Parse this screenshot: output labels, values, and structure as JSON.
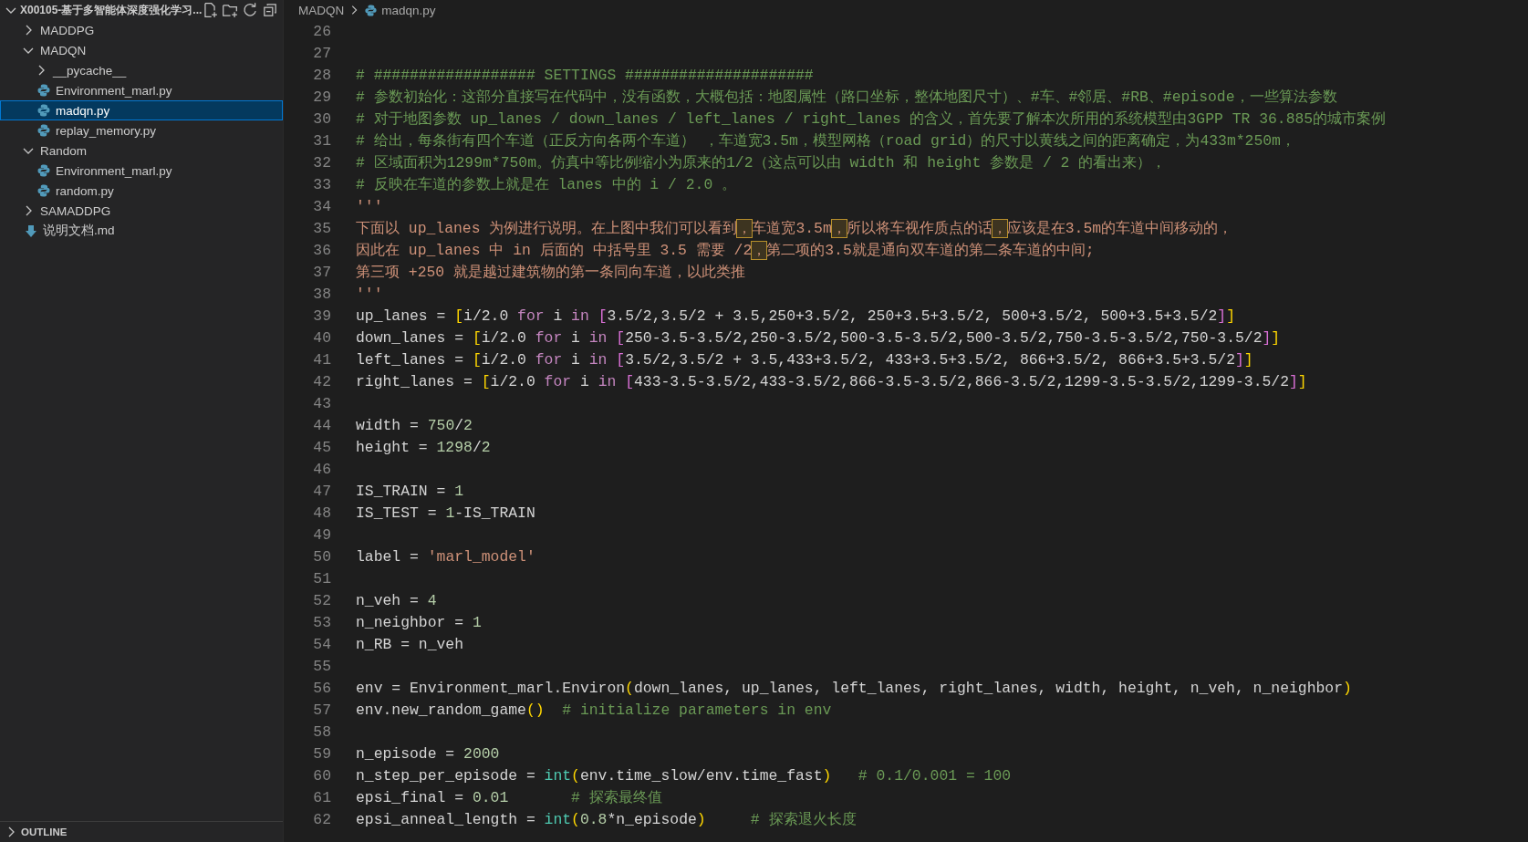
{
  "explorer": {
    "title": "X00105-基于多智能体深度强化学习...",
    "tree": [
      {
        "label": "MADDPG",
        "kind": "folder",
        "expanded": false,
        "selected": false
      },
      {
        "label": "MADQN",
        "kind": "folder",
        "expanded": true,
        "selected": false,
        "children": [
          {
            "label": "__pycache__",
            "kind": "folder",
            "expanded": false,
            "selected": false
          },
          {
            "label": "Environment_marl.py",
            "kind": "python",
            "selected": false
          },
          {
            "label": "madqn.py",
            "kind": "python",
            "selected": true
          },
          {
            "label": "replay_memory.py",
            "kind": "python",
            "selected": false
          }
        ]
      },
      {
        "label": "Random",
        "kind": "folder",
        "expanded": true,
        "selected": false,
        "children": [
          {
            "label": "Environment_marl.py",
            "kind": "python",
            "selected": false
          },
          {
            "label": "random.py",
            "kind": "python",
            "selected": false
          }
        ]
      },
      {
        "label": "SAMADDPG",
        "kind": "folder",
        "expanded": false,
        "selected": false
      },
      {
        "label": "说明文档.md",
        "kind": "markdown",
        "selected": false
      }
    ],
    "outline": {
      "title": "OUTLINE",
      "expanded": false
    }
  },
  "breadcrumbs": [
    {
      "label": "MADQN",
      "kind": "folder"
    },
    {
      "label": "madqn.py",
      "kind": "python"
    }
  ],
  "editor": {
    "lines": [
      {
        "number": "26"
      },
      {
        "number": "27"
      },
      {
        "number": "28",
        "tokens": [
          {
            "text": "# ################## SETTINGS #####################",
            "kind": "comment"
          }
        ]
      },
      {
        "number": "29",
        "tokens": [
          {
            "text": "# 参数初始化：这部分直接写在代码中，没有函数，大概包括：地图属性（路口坐标，整体地图尺寸）、#车、#邻居、#RB、#episode，一些算法参数",
            "kind": "comment"
          }
        ]
      },
      {
        "number": "30",
        "tokens": [
          {
            "text": "# 对于地图参数 up_lanes / down_lanes / left_lanes / right_lanes 的含义，首先要了解本次所用的系统模型由3GPP TR 36.885的城市案例",
            "kind": "comment"
          }
        ]
      },
      {
        "number": "31",
        "tokens": [
          {
            "text": "# 给出，每条街有四个车道（正反方向各两个车道） ，车道宽3.5m，模型网格（road grid）的尺寸以黄线之间的距离确定，为433m*250m，",
            "kind": "comment"
          }
        ]
      },
      {
        "number": "32",
        "tokens": [
          {
            "text": "# 区域面积为1299m*750m。仿真中等比例缩小为原来的1/2（这点可以由 width 和 height 参数是 / 2 的看出来），",
            "kind": "comment"
          }
        ]
      },
      {
        "number": "33",
        "tokens": [
          {
            "text": "# 反映在车道的参数上就是在 lanes 中的 i / 2.0 。",
            "kind": "comment"
          }
        ]
      },
      {
        "number": "34",
        "tokens": [
          {
            "text": "'''",
            "kind": "docstring"
          }
        ]
      },
      {
        "number": "35",
        "tokens": [
          {
            "text": "下面以 up_lanes 为例进行说明。在上图中我们可以看到",
            "kind": "docstring"
          },
          {
            "text": "，",
            "kind": "flagged"
          },
          {
            "text": "车道宽3.5m",
            "kind": "docstring"
          },
          {
            "text": "，",
            "kind": "flagged"
          },
          {
            "text": "所以将车视作质点的话",
            "kind": "docstring"
          },
          {
            "text": "，",
            "kind": "flagged"
          },
          {
            "text": "应该是在3.5m的车道中间移动的，",
            "kind": "docstring"
          }
        ]
      },
      {
        "number": "36",
        "tokens": [
          {
            "text": "因此在 up_lanes 中 in 后面的 中括号里 3.5 需要 /2",
            "kind": "docstring"
          },
          {
            "text": "，",
            "kind": "flagged"
          },
          {
            "text": "第二项的3.5就是通向双车道的第二条车道的中间;",
            "kind": "docstring"
          }
        ]
      },
      {
        "number": "37",
        "tokens": [
          {
            "text": "第三项 +250 就是越过建筑物的第一条同向车道，以此类推",
            "kind": "docstring"
          }
        ]
      },
      {
        "number": "38",
        "tokens": [
          {
            "text": "'''",
            "kind": "docstring"
          }
        ]
      },
      {
        "number": "39",
        "tokens": [
          {
            "text": "up_lanes = ",
            "kind": "plain"
          },
          {
            "text": "[",
            "kind": "bracket1"
          },
          {
            "text": "i/2.0 ",
            "kind": "plain"
          },
          {
            "text": "for",
            "kind": "keyword"
          },
          {
            "text": " i ",
            "kind": "plain"
          },
          {
            "text": "in ",
            "kind": "keyword"
          },
          {
            "text": "[",
            "kind": "bracket2"
          },
          {
            "text": "3.5/2,3.5/2 + 3.5,250+3.5/2, 250+3.5+3.5/2, 500+3.5/2, 500+3.5+3.5/2",
            "kind": "plain"
          },
          {
            "text": "]",
            "kind": "bracket2"
          },
          {
            "text": "]",
            "kind": "bracket1"
          }
        ]
      },
      {
        "number": "40",
        "tokens": [
          {
            "text": "down_lanes = ",
            "kind": "plain"
          },
          {
            "text": "[",
            "kind": "bracket1"
          },
          {
            "text": "i/2.0 ",
            "kind": "plain"
          },
          {
            "text": "for",
            "kind": "keyword"
          },
          {
            "text": " i ",
            "kind": "plain"
          },
          {
            "text": "in ",
            "kind": "keyword"
          },
          {
            "text": "[",
            "kind": "bracket2"
          },
          {
            "text": "250-3.5-3.5/2,250-3.5/2,500-3.5-3.5/2,500-3.5/2,750-3.5-3.5/2,750-3.5/2",
            "kind": "plain"
          },
          {
            "text": "]",
            "kind": "bracket2"
          },
          {
            "text": "]",
            "kind": "bracket1"
          }
        ]
      },
      {
        "number": "41",
        "tokens": [
          {
            "text": "left_lanes = ",
            "kind": "plain"
          },
          {
            "text": "[",
            "kind": "bracket1"
          },
          {
            "text": "i/2.0 ",
            "kind": "plain"
          },
          {
            "text": "for",
            "kind": "keyword"
          },
          {
            "text": " i ",
            "kind": "plain"
          },
          {
            "text": "in ",
            "kind": "keyword"
          },
          {
            "text": "[",
            "kind": "bracket2"
          },
          {
            "text": "3.5/2,3.5/2 + 3.5,433+3.5/2, 433+3.5+3.5/2, 866+3.5/2, 866+3.5+3.5/2",
            "kind": "plain"
          },
          {
            "text": "]",
            "kind": "bracket2"
          },
          {
            "text": "]",
            "kind": "bracket1"
          }
        ]
      },
      {
        "number": "42",
        "tokens": [
          {
            "text": "right_lanes = ",
            "kind": "plain"
          },
          {
            "text": "[",
            "kind": "bracket1"
          },
          {
            "text": "i/2.0 ",
            "kind": "plain"
          },
          {
            "text": "for",
            "kind": "keyword"
          },
          {
            "text": " i ",
            "kind": "plain"
          },
          {
            "text": "in ",
            "kind": "keyword"
          },
          {
            "text": "[",
            "kind": "bracket2"
          },
          {
            "text": "433-3.5-3.5/2,433-3.5/2,866-3.5-3.5/2,866-3.5/2,1299-3.5-3.5/2,1299-3.5/2",
            "kind": "plain"
          },
          {
            "text": "]",
            "kind": "bracket2"
          },
          {
            "text": "]",
            "kind": "bracket1"
          }
        ]
      },
      {
        "number": "43"
      },
      {
        "number": "44",
        "tokens": [
          {
            "text": "width = ",
            "kind": "plain"
          },
          {
            "text": "750",
            "kind": "number"
          },
          {
            "text": "/",
            "kind": "plain"
          },
          {
            "text": "2",
            "kind": "number"
          }
        ]
      },
      {
        "number": "45",
        "tokens": [
          {
            "text": "height = ",
            "kind": "plain"
          },
          {
            "text": "1298",
            "kind": "number"
          },
          {
            "text": "/",
            "kind": "plain"
          },
          {
            "text": "2",
            "kind": "number"
          }
        ]
      },
      {
        "number": "46"
      },
      {
        "number": "47",
        "tokens": [
          {
            "text": "IS_TRAIN = ",
            "kind": "plain"
          },
          {
            "text": "1",
            "kind": "number"
          }
        ]
      },
      {
        "number": "48",
        "tokens": [
          {
            "text": "IS_TEST = ",
            "kind": "plain"
          },
          {
            "text": "1",
            "kind": "number"
          },
          {
            "text": "-IS_TRAIN",
            "kind": "plain"
          }
        ]
      },
      {
        "number": "49"
      },
      {
        "number": "50",
        "tokens": [
          {
            "text": "label = ",
            "kind": "plain"
          },
          {
            "text": "'marl_model'",
            "kind": "string"
          }
        ]
      },
      {
        "number": "51"
      },
      {
        "number": "52",
        "tokens": [
          {
            "text": "n_veh = ",
            "kind": "plain"
          },
          {
            "text": "4",
            "kind": "number"
          }
        ]
      },
      {
        "number": "53",
        "tokens": [
          {
            "text": "n_neighbor = ",
            "kind": "plain"
          },
          {
            "text": "1",
            "kind": "number"
          }
        ]
      },
      {
        "number": "54",
        "tokens": [
          {
            "text": "n_RB = n_veh",
            "kind": "plain"
          }
        ]
      },
      {
        "number": "55"
      },
      {
        "number": "56",
        "tokens": [
          {
            "text": "env = Environment_marl.Environ",
            "kind": "plain"
          },
          {
            "text": "(",
            "kind": "bracket1"
          },
          {
            "text": "down_lanes, up_lanes, left_lanes, right_lanes, width, height, n_veh, n_neighbor",
            "kind": "plain"
          },
          {
            "text": ")",
            "kind": "bracket1"
          }
        ]
      },
      {
        "number": "57",
        "tokens": [
          {
            "text": "env.new_random_game",
            "kind": "plain"
          },
          {
            "text": "()",
            "kind": "bracket1"
          },
          {
            "text": "  # initialize parameters in env",
            "kind": "comment"
          }
        ]
      },
      {
        "number": "58"
      },
      {
        "number": "59",
        "tokens": [
          {
            "text": "n_episode = ",
            "kind": "plain"
          },
          {
            "text": "2000",
            "kind": "number"
          }
        ]
      },
      {
        "number": "60",
        "tokens": [
          {
            "text": "n_step_per_episode = ",
            "kind": "plain"
          },
          {
            "text": "int",
            "kind": "builtin"
          },
          {
            "text": "(",
            "kind": "bracket1"
          },
          {
            "text": "env.time_slow/env.time_fast",
            "kind": "plain"
          },
          {
            "text": ")",
            "kind": "bracket1"
          },
          {
            "text": "   # 0.1/0.001 = 100",
            "kind": "comment"
          }
        ]
      },
      {
        "number": "61",
        "tokens": [
          {
            "text": "epsi_final = ",
            "kind": "plain"
          },
          {
            "text": "0.01",
            "kind": "number"
          },
          {
            "text": "       # 探索最终值",
            "kind": "comment"
          }
        ]
      },
      {
        "number": "62",
        "tokens": [
          {
            "text": "epsi_anneal_length = ",
            "kind": "plain"
          },
          {
            "text": "int",
            "kind": "builtin"
          },
          {
            "text": "(",
            "kind": "bracket1"
          },
          {
            "text": "0.8",
            "kind": "number"
          },
          {
            "text": "*n_episode",
            "kind": "plain"
          },
          {
            "text": ")",
            "kind": "bracket1"
          },
          {
            "text": "     # 探索退火长度",
            "kind": "comment"
          }
        ]
      }
    ]
  }
}
